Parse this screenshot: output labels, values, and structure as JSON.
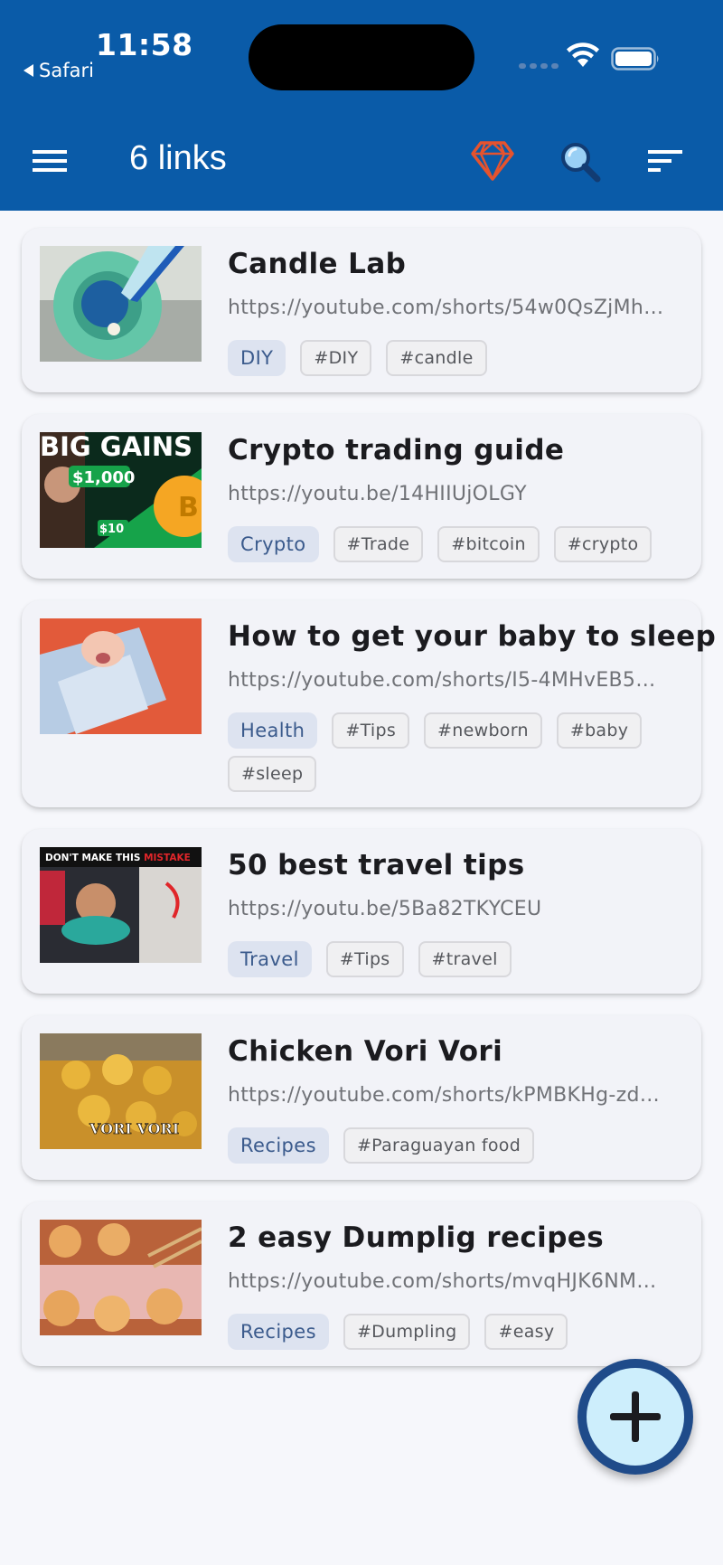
{
  "status_bar": {
    "time": "11:58",
    "back_app": "Safari"
  },
  "toolbar": {
    "title": "6 links",
    "icons": [
      "menu-icon",
      "premium-gem-icon",
      "search-icon",
      "sort-icon"
    ]
  },
  "colors": {
    "header": "#0a5ba8",
    "background": "#f6f7fb",
    "card": "#f2f3f8",
    "category_chip": "#dde3f0",
    "premium_icon": "#e5532e",
    "fab": "#cdeefc"
  },
  "links": [
    {
      "title": "Candle Lab",
      "url": "https://youtube.com/shorts/54w0QsZjMh…",
      "category": "DIY",
      "tags": [
        "#DIY",
        "#candle"
      ]
    },
    {
      "title": "Crypto trading guide",
      "url": "https://youtu.be/14HIIUjOLGY",
      "category": "Crypto",
      "tags": [
        "#Trade",
        "#bitcoin",
        "#crypto"
      ],
      "thumb_text": [
        "BIG GAINS",
        "$1,000",
        "$10"
      ]
    },
    {
      "title": "How to get your baby to sleep",
      "url": "https://youtube.com/shorts/I5-4MHvEB5…",
      "category": "Health",
      "tags": [
        "#Tips",
        "#newborn",
        "#baby",
        "#sleep"
      ]
    },
    {
      "title": "50 best travel tips",
      "url": "https://youtu.be/5Ba82TKYCEU",
      "category": "Travel",
      "tags": [
        "#Tips",
        "#travel"
      ],
      "thumb_text": [
        "DON'T MAKE THIS ",
        "MISTAKE"
      ]
    },
    {
      "title": "Chicken Vori Vori",
      "url": "https://youtube.com/shorts/kPMBKHg-zd…",
      "category": "Recipes",
      "tags": [
        "#Paraguayan food"
      ],
      "thumb_text": [
        "VORI VORI"
      ]
    },
    {
      "title": "2 easy Dumplig recipes",
      "url": "https://youtube.com/shorts/mvqHJK6NM…",
      "category": "Recipes",
      "tags": [
        "#Dumpling",
        "#easy"
      ]
    }
  ],
  "fab": {
    "icon": "plus-icon"
  }
}
